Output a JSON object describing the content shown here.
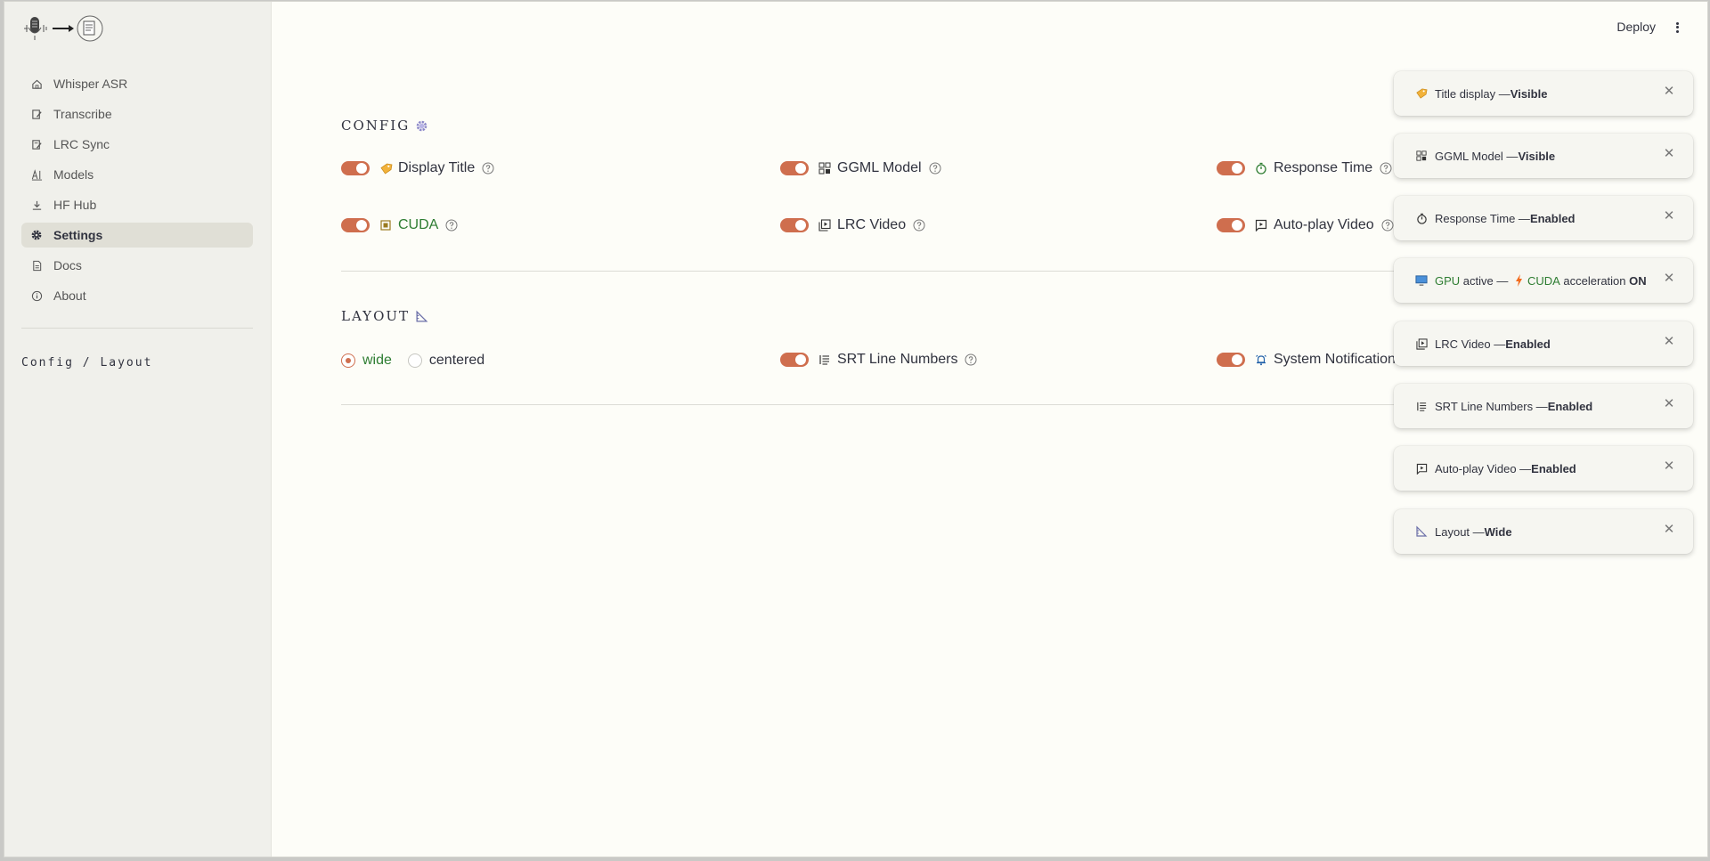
{
  "header": {
    "deploy_label": "Deploy"
  },
  "sidebar": {
    "items": [
      {
        "label": "Whisper ASR",
        "icon": "home-icon"
      },
      {
        "label": "Transcribe",
        "icon": "edit-icon"
      },
      {
        "label": "LRC Sync",
        "icon": "sync-edit-icon"
      },
      {
        "label": "Models",
        "icon": "ai-icon"
      },
      {
        "label": "HF Hub",
        "icon": "download-icon"
      },
      {
        "label": "Settings",
        "icon": "gear-icon",
        "active": true
      },
      {
        "label": "Docs",
        "icon": "document-icon"
      },
      {
        "label": "About",
        "icon": "info-icon"
      }
    ],
    "breadcrumb": "Config / Layout"
  },
  "config": {
    "title": "CONFIG",
    "options": [
      {
        "label": "Display Title",
        "enabled": true
      },
      {
        "label": "GGML Model",
        "enabled": true
      },
      {
        "label": "Response Time",
        "enabled": true
      },
      {
        "label": "CUDA",
        "enabled": true
      },
      {
        "label": "LRC Video",
        "enabled": true
      },
      {
        "label": "Auto-play Video",
        "enabled": true
      }
    ]
  },
  "layout": {
    "title": "LAYOUT",
    "radio": {
      "options": [
        "wide",
        "centered"
      ],
      "selected": "wide"
    },
    "options": [
      {
        "label": "SRT Line Numbers",
        "enabled": true
      },
      {
        "label": "System Notifications",
        "enabled": true
      }
    ]
  },
  "toasts": [
    {
      "prefix": "Title display — ",
      "value": "Visible"
    },
    {
      "prefix": "GGML Model — ",
      "value": "Visible"
    },
    {
      "prefix": "Response Time — ",
      "value": "Enabled"
    },
    {
      "gpu": "GPU",
      "active": " active — ",
      "cuda": "CUDA",
      "accel": " acceleration ",
      "value": "ON"
    },
    {
      "prefix": "LRC Video — ",
      "value": "Enabled"
    },
    {
      "prefix": "SRT Line Numbers — ",
      "value": "Enabled"
    },
    {
      "prefix": "Auto-play Video — ",
      "value": "Enabled"
    },
    {
      "prefix": "Layout — ",
      "value": "Wide"
    }
  ],
  "colors": {
    "accent": "#cf6e4e",
    "green_text": "#2e7d32",
    "sidebar_bg": "#f0f0eb",
    "page_bg": "#fdfdf8"
  }
}
